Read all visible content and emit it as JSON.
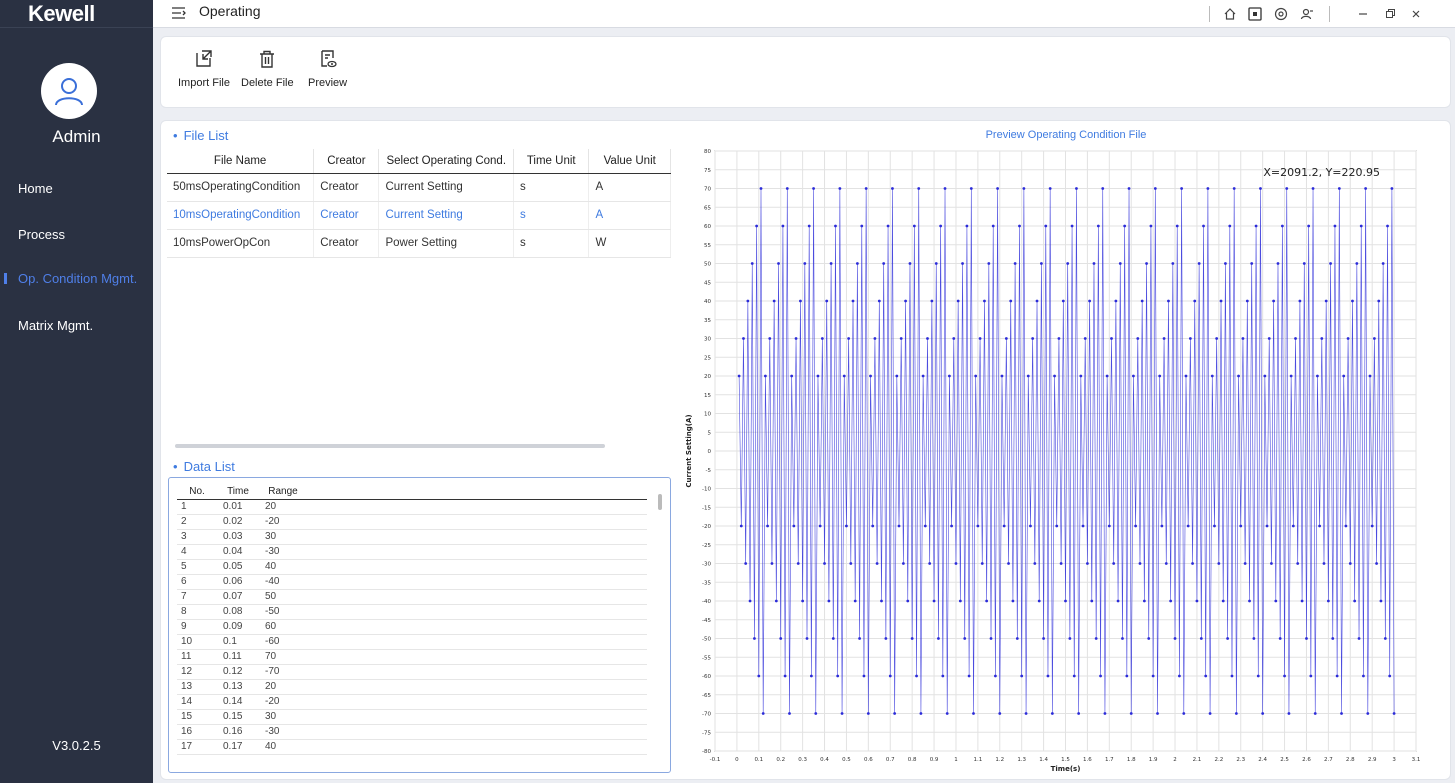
{
  "app": {
    "logo": "Kewell",
    "window_title": "Operating",
    "version": "V3.0.2.5"
  },
  "user": {
    "name": "Admin"
  },
  "sidebar": {
    "items": [
      {
        "label": "Home",
        "active": false
      },
      {
        "label": "Process",
        "active": false
      },
      {
        "label": "Op. Condition Mgmt.",
        "active": true
      },
      {
        "label": "Matrix Mgmt.",
        "active": false
      }
    ]
  },
  "toolbar": {
    "import_label": "Import File",
    "delete_label": "Delete File",
    "preview_label": "Preview"
  },
  "file_list": {
    "title": "File List",
    "columns": [
      "File Name",
      "Creator",
      "Select Operating Cond.",
      "Time Unit",
      "Value Unit"
    ],
    "rows": [
      [
        "50msOperatingCondition",
        "Creator",
        "Current Setting",
        "s",
        "A"
      ],
      [
        "10msOperatingCondition",
        "Creator",
        "Current Setting",
        "s",
        "A"
      ],
      [
        "10msPowerOpCon",
        "Creator",
        "Power Setting",
        "s",
        "W"
      ]
    ],
    "selected_row": 1
  },
  "data_list": {
    "title": "Data List",
    "columns": [
      "No.",
      "Time",
      "Range"
    ],
    "rows": [
      [
        "1",
        "0.01",
        "20"
      ],
      [
        "2",
        "0.02",
        "-20"
      ],
      [
        "3",
        "0.03",
        "30"
      ],
      [
        "4",
        "0.04",
        "-30"
      ],
      [
        "5",
        "0.05",
        "40"
      ],
      [
        "6",
        "0.06",
        "-40"
      ],
      [
        "7",
        "0.07",
        "50"
      ],
      [
        "8",
        "0.08",
        "-50"
      ],
      [
        "9",
        "0.09",
        "60"
      ],
      [
        "10",
        "0.1",
        "-60"
      ],
      [
        "11",
        "0.11",
        "70"
      ],
      [
        "12",
        "0.12",
        "-70"
      ],
      [
        "13",
        "0.13",
        "20"
      ],
      [
        "14",
        "0.14",
        "-20"
      ],
      [
        "15",
        "0.15",
        "30"
      ],
      [
        "16",
        "0.16",
        "-30"
      ],
      [
        "17",
        "0.17",
        "40"
      ]
    ]
  },
  "chart_data": {
    "type": "line",
    "title": "Preview Operating Condition File",
    "xlabel": "Time(s)",
    "ylabel": "Current Setting(A)",
    "cursor_readout": "X=2091.2, Y=220.95",
    "xlim": [
      -0.1,
      3.1
    ],
    "ylim": [
      -80,
      80
    ],
    "x_step": 0.1,
    "y_step": 5,
    "x_tick_labels": [
      "-0.1",
      "0",
      "0.1",
      "0.2",
      "0.3",
      "0.4",
      "0.5",
      "0.6",
      "0.7",
      "0.8",
      "0.9",
      "1",
      "1.1",
      "1.2",
      "1.3",
      "1.4",
      "1.5",
      "1.6",
      "1.7",
      "1.8",
      "1.9",
      "2",
      "2.1",
      "2.2",
      "2.3",
      "2.4",
      "2.5",
      "2.6",
      "2.7",
      "2.8",
      "2.9",
      "3",
      "3.1"
    ],
    "y_tick_labels": [
      "80",
      "75",
      "70",
      "65",
      "60",
      "55",
      "50",
      "45",
      "40",
      "35",
      "30",
      "25",
      "20",
      "15",
      "10",
      "5",
      "0",
      "-5",
      "-10",
      "-15",
      "-20",
      "-25",
      "-30",
      "-35",
      "-40",
      "-45",
      "-50",
      "-55",
      "-60",
      "-65",
      "-70",
      "-75",
      "-80"
    ],
    "grid": true,
    "series": [
      {
        "sample_interval": 0.01,
        "x_start": 0.01,
        "x_end": 3.0,
        "cycle_values": [
          20,
          -20,
          30,
          -30,
          40,
          -40,
          50,
          -50,
          60,
          -60,
          70,
          -70
        ],
        "color": "#2b2bd9"
      }
    ]
  },
  "colors": {
    "accent": "#3f7be0",
    "sidebar_bg": "#2a3142",
    "series": "#2b2bd9"
  }
}
